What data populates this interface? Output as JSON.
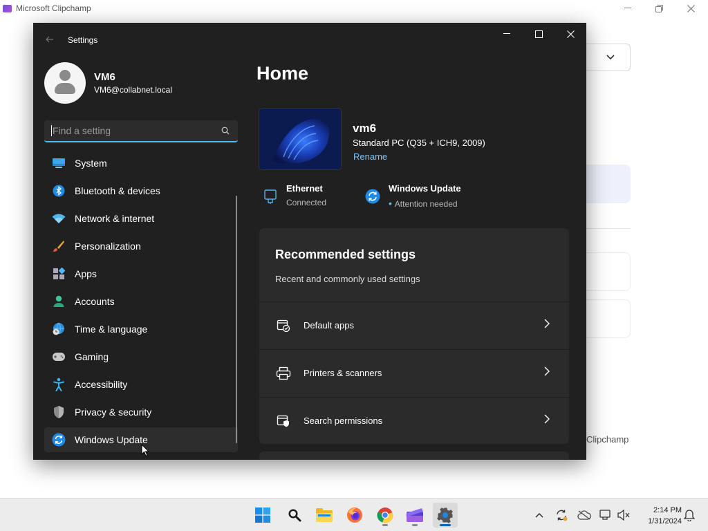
{
  "background_app": {
    "title": "Microsoft Clipchamp",
    "label": "Clipchamp"
  },
  "settings": {
    "window_title": "Settings",
    "profile": {
      "name": "VM6",
      "email": "VM6@collabnet.local"
    },
    "search": {
      "placeholder": "Find a setting",
      "value": ""
    },
    "nav": [
      {
        "label": "System",
        "icon": "system-icon"
      },
      {
        "label": "Bluetooth & devices",
        "icon": "bluetooth-icon"
      },
      {
        "label": "Network & internet",
        "icon": "wifi-icon"
      },
      {
        "label": "Personalization",
        "icon": "brush-icon"
      },
      {
        "label": "Apps",
        "icon": "apps-icon"
      },
      {
        "label": "Accounts",
        "icon": "accounts-icon"
      },
      {
        "label": "Time & language",
        "icon": "globe-clock-icon"
      },
      {
        "label": "Gaming",
        "icon": "gamepad-icon"
      },
      {
        "label": "Accessibility",
        "icon": "accessibility-icon"
      },
      {
        "label": "Privacy & security",
        "icon": "shield-icon"
      },
      {
        "label": "Windows Update",
        "icon": "update-icon",
        "active": true
      }
    ],
    "home": {
      "title": "Home",
      "device": {
        "name": "vm6",
        "model": "Standard PC (Q35 + ICH9, 2009)",
        "rename_label": "Rename"
      },
      "status": [
        {
          "title": "Ethernet",
          "subtitle": "Connected",
          "icon": "ethernet-icon"
        },
        {
          "title": "Windows Update",
          "subtitle": "Attention needed",
          "icon": "update-icon"
        }
      ],
      "recommended": {
        "title": "Recommended settings",
        "subtitle": "Recent and commonly used settings",
        "items": [
          {
            "label": "Default apps",
            "icon": "default-apps-icon"
          },
          {
            "label": "Printers & scanners",
            "icon": "printer-icon"
          },
          {
            "label": "Search permissions",
            "icon": "search-permissions-icon"
          }
        ]
      }
    }
  },
  "taskbar": {
    "apps": [
      "start-icon",
      "search-icon",
      "file-explorer-icon",
      "firefox-icon",
      "chrome-icon",
      "clipchamp-icon",
      "settings-icon"
    ],
    "active_app": "settings-icon",
    "time": "2:14 PM",
    "date": "1/31/2024"
  },
  "colors": {
    "accent": "#4cc2ff",
    "link": "#7cc4f6",
    "window_bg": "#202020",
    "card_bg": "#2b2b2b"
  }
}
